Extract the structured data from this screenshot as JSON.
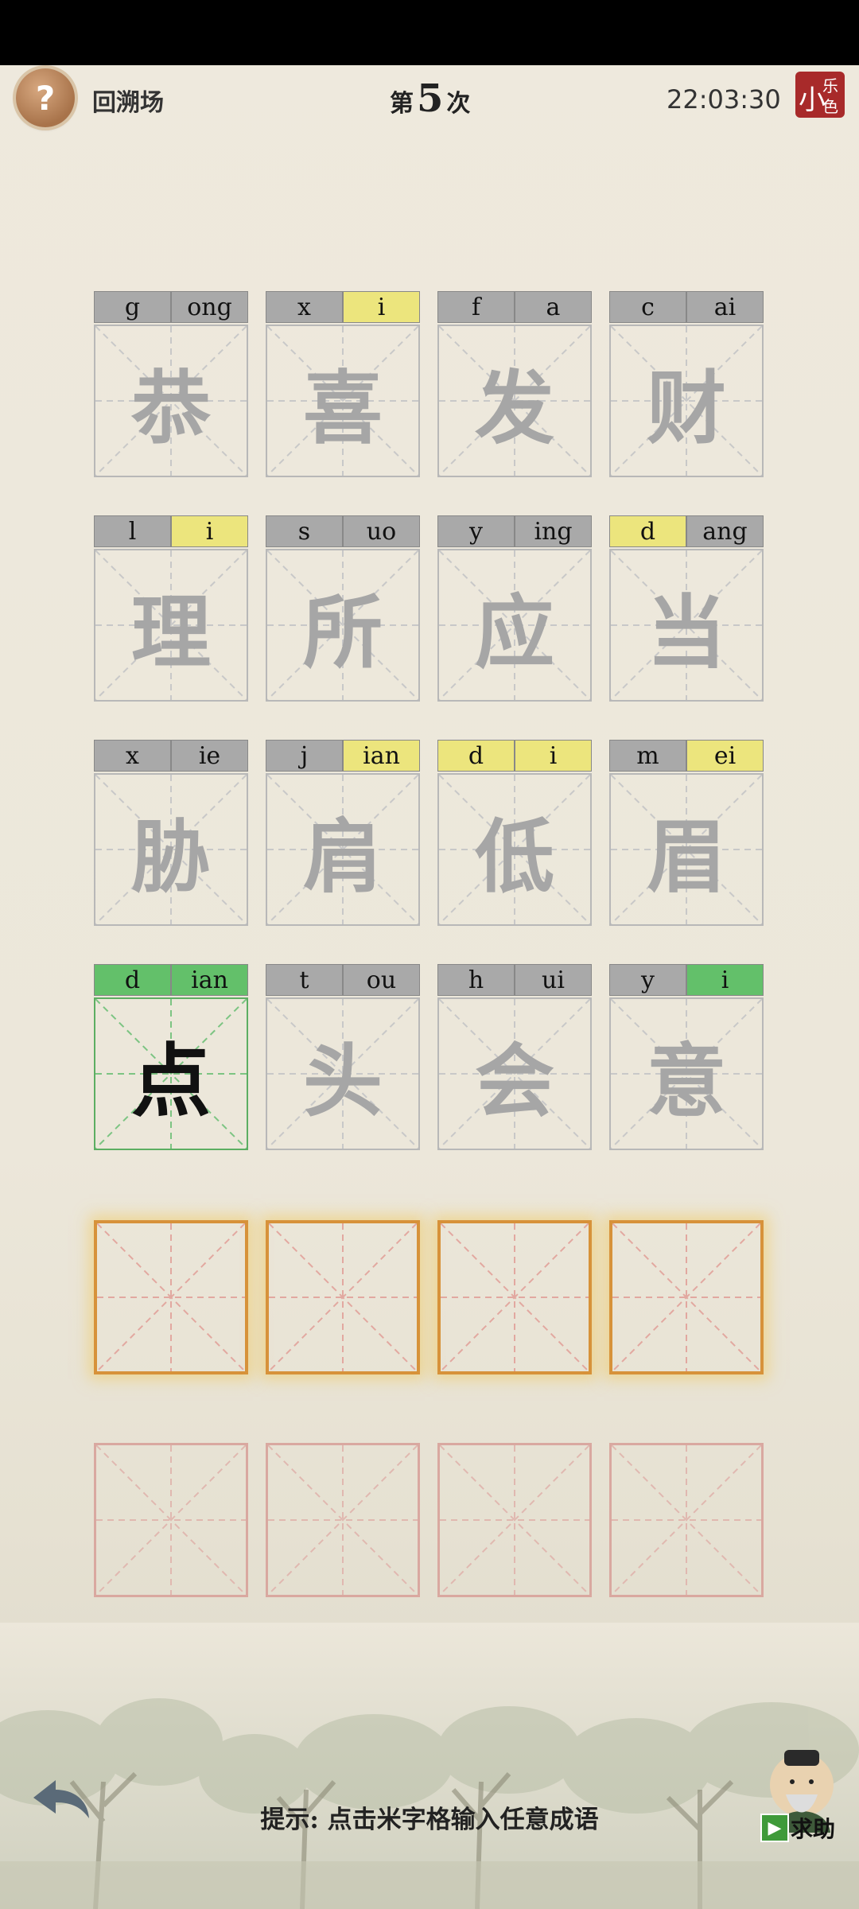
{
  "header": {
    "help_icon": "?",
    "back_label": "回溯场",
    "round_prefix": "第",
    "round_number": "5",
    "round_suffix": "次",
    "timer": "22:03:30",
    "logo": {
      "a": "小",
      "b": "乐",
      "c": "色"
    }
  },
  "rows": [
    [
      {
        "initial": "g",
        "final": "ong",
        "char": "恭",
        "initial_state": "gray",
        "final_state": "gray"
      },
      {
        "initial": "x",
        "final": "i",
        "char": "喜",
        "initial_state": "gray",
        "final_state": "yellow"
      },
      {
        "initial": "f",
        "final": "a",
        "char": "发",
        "initial_state": "gray",
        "final_state": "gray"
      },
      {
        "initial": "c",
        "final": "ai",
        "char": "财",
        "initial_state": "gray",
        "final_state": "gray"
      }
    ],
    [
      {
        "initial": "l",
        "final": "i",
        "char": "理",
        "initial_state": "gray",
        "final_state": "yellow"
      },
      {
        "initial": "s",
        "final": "uo",
        "char": "所",
        "initial_state": "gray",
        "final_state": "gray"
      },
      {
        "initial": "y",
        "final": "ing",
        "char": "应",
        "initial_state": "gray",
        "final_state": "gray"
      },
      {
        "initial": "d",
        "final": "ang",
        "char": "当",
        "initial_state": "yellow",
        "final_state": "gray"
      }
    ],
    [
      {
        "initial": "x",
        "final": "ie",
        "char": "胁",
        "initial_state": "gray",
        "final_state": "gray"
      },
      {
        "initial": "j",
        "final": "ian",
        "char": "肩",
        "initial_state": "gray",
        "final_state": "yellow"
      },
      {
        "initial": "d",
        "final": "i",
        "char": "低",
        "initial_state": "yellow",
        "final_state": "yellow"
      },
      {
        "initial": "m",
        "final": "ei",
        "char": "眉",
        "initial_state": "gray",
        "final_state": "yellow"
      }
    ],
    [
      {
        "initial": "d",
        "final": "ian",
        "char": "点",
        "initial_state": "green",
        "final_state": "green"
      },
      {
        "initial": "t",
        "final": "ou",
        "char": "头",
        "initial_state": "gray",
        "final_state": "gray"
      },
      {
        "initial": "h",
        "final": "ui",
        "char": "会",
        "initial_state": "gray",
        "final_state": "gray"
      },
      {
        "initial": "y",
        "final": "i",
        "char": "意",
        "initial_state": "gray",
        "final_state": "green"
      }
    ]
  ],
  "footer": {
    "hint": "提示: 点击米字格输入任意成语",
    "ask_label": "求助",
    "back_icon": "back-arrow-icon",
    "play_icon": "play-icon"
  },
  "colors": {
    "gray": "#a9a9a9",
    "yellow": "#ece57d",
    "green": "#63c06a",
    "active_border": "#5cae62",
    "input_border": "#d7923a",
    "empty_border": "#d9a8a0"
  }
}
